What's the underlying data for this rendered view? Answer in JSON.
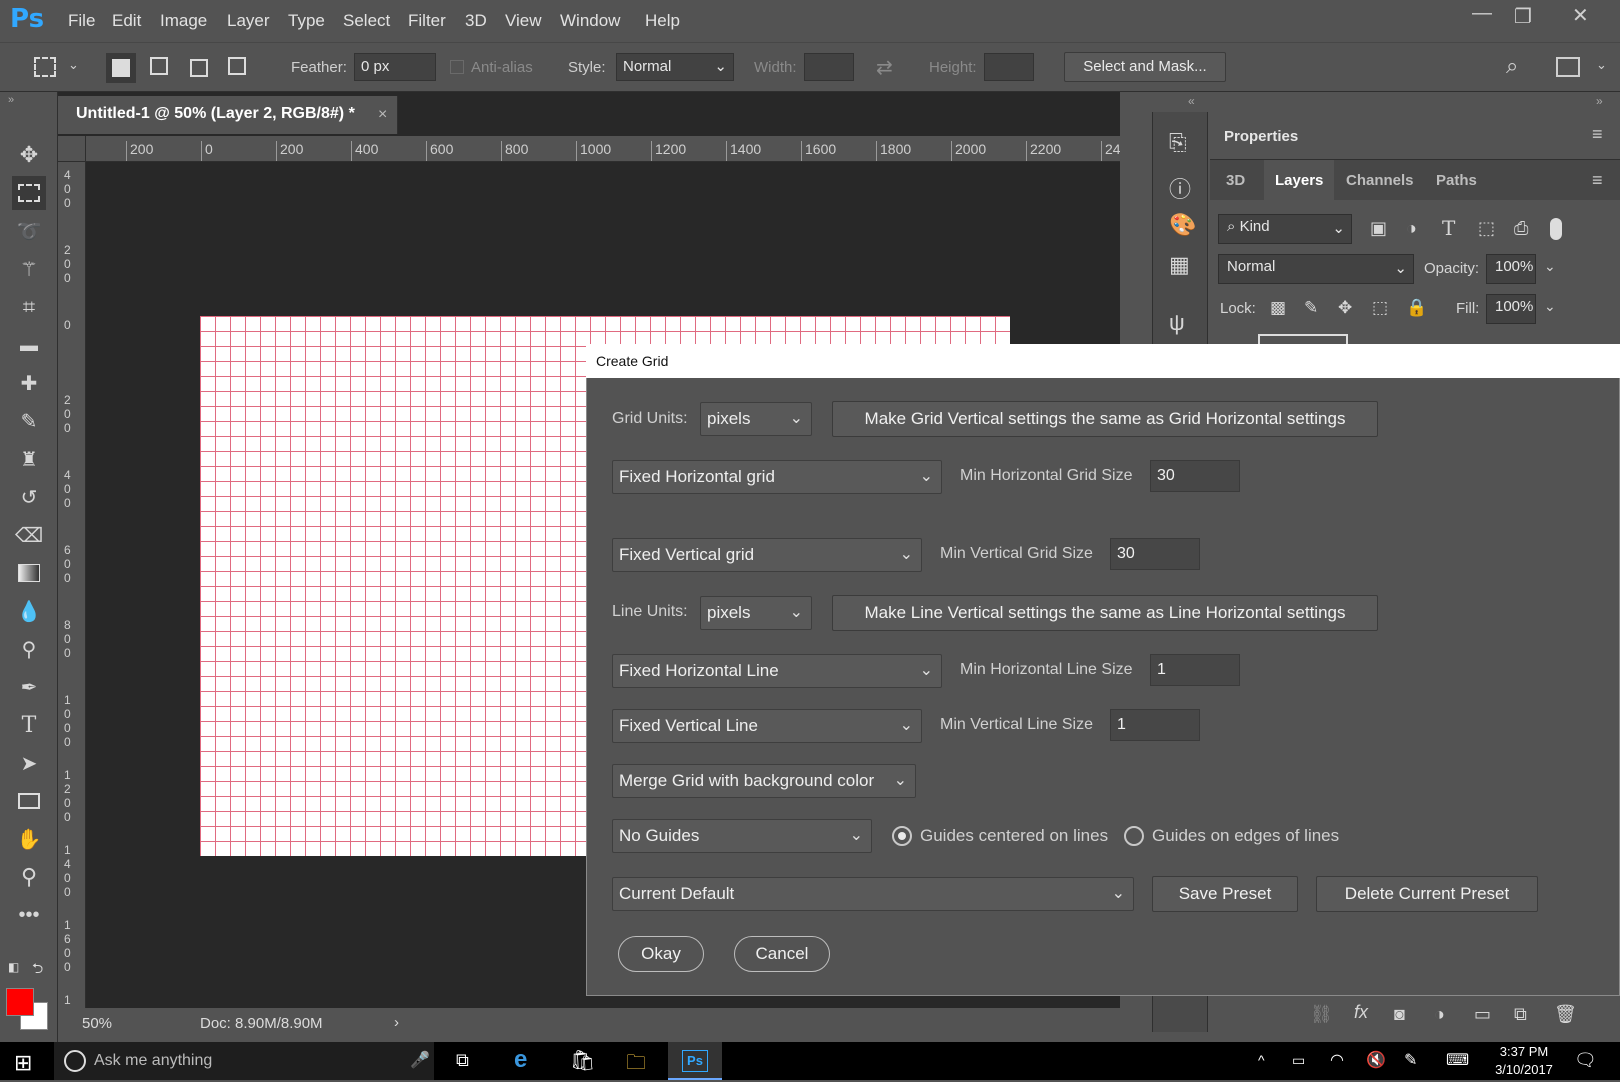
{
  "app": {
    "logo": "Ps",
    "menus": [
      "File",
      "Edit",
      "Image",
      "Layer",
      "Type",
      "Select",
      "Filter",
      "3D",
      "View",
      "Window",
      "Help"
    ]
  },
  "options": {
    "feather_label": "Feather:",
    "feather_value": "0 px",
    "antialias_label": "Anti-alias",
    "style_label": "Style:",
    "style_value": "Normal",
    "width_label": "Width:",
    "height_label": "Height:",
    "select_mask": "Select and Mask..."
  },
  "document": {
    "tab_title": "Untitled-1 @ 50% (Layer 2, RGB/8#) *",
    "close": "×",
    "zoom": "50%",
    "doc_size": "Doc: 8.90M/8.90M",
    "hruler": [
      "200",
      "0",
      "200",
      "400",
      "600",
      "800",
      "1000",
      "1200",
      "1400",
      "1600",
      "1800",
      "2000",
      "2200",
      "240"
    ],
    "vruler": [
      "400",
      "200",
      "0",
      "200",
      "400",
      "600",
      "800",
      "1000",
      "1200",
      "1400",
      "1600",
      "1"
    ]
  },
  "panels": {
    "properties_title": "Properties",
    "tabs": [
      "3D",
      "Layers",
      "Channels",
      "Paths"
    ],
    "active_tab": "Layers",
    "kind_label": "Kind",
    "blend_mode": "Normal",
    "opacity_label": "Opacity:",
    "opacity_value": "100%",
    "lock_label": "Lock:",
    "fill_label": "Fill:",
    "fill_value": "100%"
  },
  "dialog": {
    "title": "Create Grid",
    "grid_units_label": "Grid Units:",
    "grid_units_value": "pixels",
    "make_grid_same": "Make Grid Vertical settings the same as Grid Horizontal settings",
    "h_grid_mode": "Fixed Horizontal grid",
    "min_h_grid_label": "Min Horizontal Grid Size",
    "min_h_grid_value": "30",
    "v_grid_mode": "Fixed Vertical grid",
    "min_v_grid_label": "Min Vertical Grid Size",
    "min_v_grid_value": "30",
    "line_units_label": "Line Units:",
    "line_units_value": "pixels",
    "make_line_same": "Make Line Vertical settings the same as Line Horizontal settings",
    "h_line_mode": "Fixed Horizontal Line",
    "min_h_line_label": "Min Horizontal Line Size",
    "min_h_line_value": "1",
    "v_line_mode": "Fixed Vertical Line",
    "min_v_line_label": "Min Vertical Line Size",
    "min_v_line_value": "1",
    "merge_mode": "Merge Grid with background color",
    "guides_mode": "No Guides",
    "radio_centered": "Guides centered on lines",
    "radio_edges": "Guides on edges of lines",
    "radio_selected": "centered",
    "preset_value": "Current Default",
    "save_preset": "Save Preset",
    "delete_preset": "Delete Current Preset",
    "okay": "Okay",
    "cancel": "Cancel"
  },
  "taskbar": {
    "search_placeholder": "Ask me anything",
    "time": "3:37 PM",
    "date": "3/10/2017"
  },
  "colors": {
    "foreground": "#ff0000",
    "background": "#ffffff",
    "grid_line": "#e06a80",
    "ps_blue": "#31a8ff"
  }
}
